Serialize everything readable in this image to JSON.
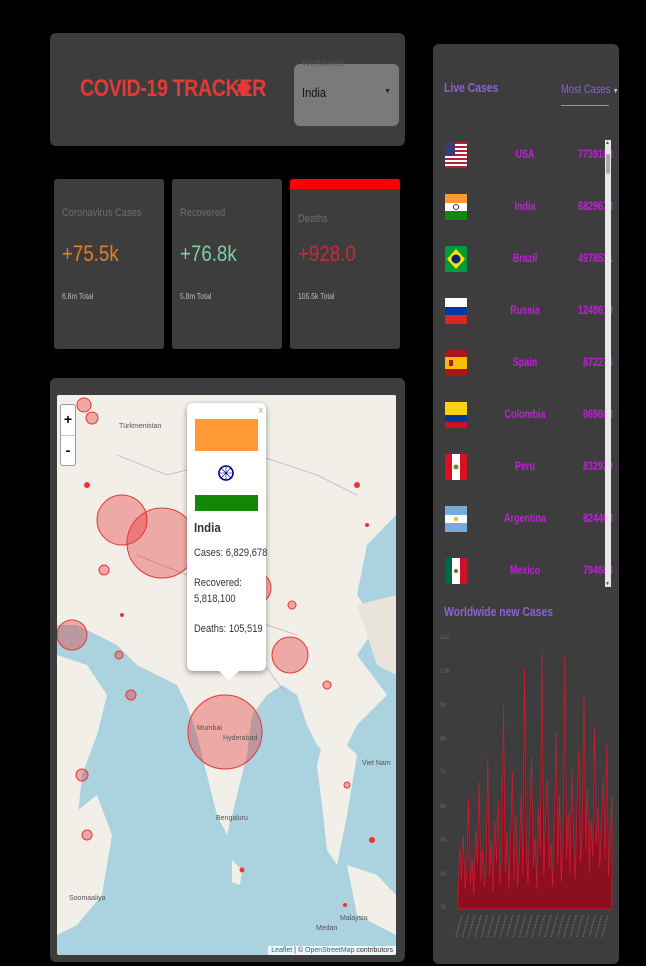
{
  "header": {
    "title": "COVID-19 TRACKER",
    "select_label": "Worldwide",
    "select_value": "India"
  },
  "stats": [
    {
      "title": "Coronavirus Cases",
      "value": "+75.5k",
      "total": "6.8m Total",
      "color": "#e67e22"
    },
    {
      "title": "Recovered",
      "value": "+76.8k",
      "total": "5.8m Total",
      "color": "#7dcea0"
    },
    {
      "title": "Deaths",
      "value": "+928.0",
      "total": "105.5k Total",
      "color": "#cc2a36"
    }
  ],
  "map": {
    "zoom_in": "+",
    "zoom_out": "-",
    "popup": {
      "close": "x",
      "country": "India",
      "cases": "Cases: 6,829,678",
      "recovered_1": "Recovered:",
      "recovered_2": "5,818,100",
      "deaths": "Deaths: 105,519"
    },
    "attribution_leaflet": "Leaflet",
    "attribution_sep": " | © ",
    "attribution_osm": "OpenStreetMap",
    "attribution_tail": " contributors",
    "place_labels": [
      "Türkmenistan",
      "Mumbai",
      "Hyderabad",
      "Bengaluru",
      "Viet Nam",
      "Malaysia",
      "Medan",
      "Soomaaliya"
    ]
  },
  "sidebar": {
    "live_cases_title": "Live Cases",
    "sort_label": "Most Cases",
    "sort_caret": "▼",
    "scroll_up": "▲",
    "scroll_down": "▼",
    "countries": [
      {
        "name": "USA",
        "cases": "7739108",
        "flag": "us-flag"
      },
      {
        "name": "India",
        "cases": "6829678",
        "flag": "india-flag"
      },
      {
        "name": "Brazil",
        "cases": "4978531",
        "flag": "brazil-flag"
      },
      {
        "name": "Russia",
        "cases": "1248619",
        "flag": "russia-flag"
      },
      {
        "name": "Spain",
        "cases": "872276",
        "flag": "spain-flag"
      },
      {
        "name": "Colombia",
        "cases": "869808",
        "flag": "colombia-flag"
      },
      {
        "name": "Peru",
        "cases": "832929",
        "flag": "peru-flag"
      },
      {
        "name": "Argentina",
        "cases": "824468",
        "flag": "argentina-flag"
      },
      {
        "name": "Mexico",
        "cases": "794608",
        "flag": "mexico-flag"
      }
    ],
    "chart_title": "Worldwide new Cases"
  },
  "colors": {
    "accent_red": "#e53935",
    "purple": "#8a63d2",
    "magenta": "#c020d8",
    "circle_fill": "rgba(225,40,40,0.35)"
  },
  "chart_data": {
    "type": "area",
    "title": "Worldwide new Cases",
    "ylim": [
      0,
      11
    ],
    "y_ticks": [
      "11k",
      "10k",
      "9k",
      "8k",
      "7k",
      "6k",
      "5k",
      "4k",
      "3k"
    ],
    "grid": false,
    "values": [
      0.5,
      2.5,
      1.2,
      3.0,
      0.8,
      1.5,
      4.5,
      1.0,
      2.0,
      0.6,
      3.2,
      1.8,
      5.2,
      1.1,
      2.4,
      0.9,
      1.6,
      6.1,
      1.3,
      2.8,
      0.7,
      3.6,
      1.9,
      4.4,
      1.0,
      2.2,
      8.3,
      1.5,
      3.1,
      0.8,
      2.6,
      5.6,
      1.2,
      3.8,
      0.9,
      2.0,
      4.7,
      1.4,
      9.8,
      2.3,
      1.0,
      3.4,
      6.2,
      1.7,
      2.9,
      0.8,
      4.1,
      2.2,
      10.5,
      1.3,
      3.7,
      5.3,
      1.6,
      2.7,
      0.9,
      3.3,
      7.2,
      1.8,
      4.6,
      1.1,
      2.5,
      10.3,
      2.0,
      3.9,
      1.4,
      5.7,
      2.8,
      1.2,
      4.3,
      6.5,
      1.9,
      3.1,
      8.8,
      2.4,
      4.9,
      1.5,
      3.6,
      2.1,
      7.5,
      2.6,
      4.2,
      1.7,
      3.3,
      5.4,
      2.0,
      6.8,
      1.3,
      2.9,
      4.6
    ]
  }
}
